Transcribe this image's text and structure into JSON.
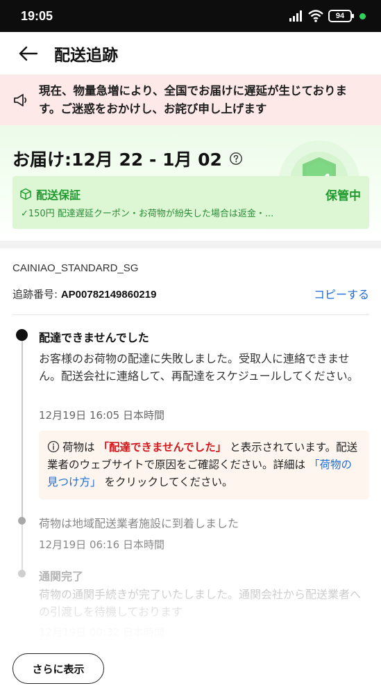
{
  "status_bar": {
    "time": "19:05",
    "battery": "94"
  },
  "header": {
    "title": "配送追跡"
  },
  "notice": {
    "text": "現在、物量急増により、全国でお届けに遅延が生じております。ご迷惑をおかけし、お詫び申し上げます"
  },
  "delivery": {
    "estimate": "お届け:12月 22 - 1月 02",
    "guarantee_title": "配送保証",
    "guarantee_status": "保管中",
    "guarantee_desc": "✓150円 配達遅延クーポン・お荷物が紛失した場合は返金・..."
  },
  "tracking": {
    "carrier": "CAINIAO_STANDARD_SG",
    "number_label": "追跡番号: ",
    "number": "AP00782149860219",
    "copy_label": "コピーする"
  },
  "events": [
    {
      "title": "配達できませんでした",
      "description": "お客様のお荷物の配達に失敗しました。受取人に連絡できません。配送会社に連絡して、再配達をスケジュールしてください。",
      "time": "12月19日 16:05 日本時間"
    },
    {
      "title": "荷物は地域配送業者施設に到着しました",
      "time": "12月19日 06:16 日本時間"
    },
    {
      "title": "通関完了",
      "description": "荷物の通関手続きが完了いたしました。通関会社から配送業者への引渡しを待機しております",
      "time": "12月19日 00:32 日本時間"
    }
  ],
  "info_box": {
    "part1": "荷物は",
    "highlight": "「配達できませんでした」",
    "part2": "と表示されています。配送業者のウェブサイトで原因をご確認ください。詳細は",
    "link": "「荷物の見つけ方」",
    "part3": "をクリックしてください。"
  },
  "more_button": {
    "label": "さらに表示"
  },
  "colors": {
    "accent_green": "#1f9a2e",
    "link_blue": "#1c6cd8",
    "alert_red": "#d0181d",
    "notice_bg": "#fde9e8"
  }
}
